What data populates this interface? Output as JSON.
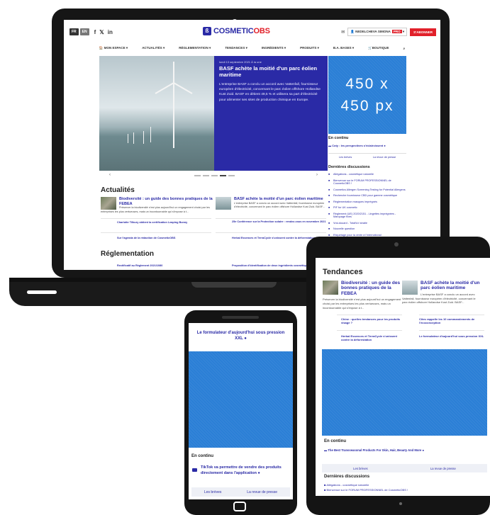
{
  "colors": {
    "brand_blue": "#2a2aa6",
    "brand_red": "#e1202a",
    "ad_blue": "#2b7fd6",
    "device_black": "#141414"
  },
  "header": {
    "languages": [
      "FR",
      "EN"
    ],
    "social": [
      "f",
      "𝕏",
      "in"
    ],
    "logo_prefix": "COSMETIC",
    "logo_suffix": "OBS",
    "mail_icon": "envelope-icon",
    "user": "NEDELCHEVA SIMONA",
    "user_badge": "PRO",
    "subscribe": "S'ABONNER"
  },
  "nav": [
    "MON ESPACE",
    "ACTUALITÉS",
    "RÉGLEMENTATION",
    "TENDANCES",
    "INGRÉDIENTS",
    "PRODUITS",
    "B.A. BASES",
    "BOUTIQUE"
  ],
  "hero": {
    "meta": "lundi 13 septembre 2021   À la une",
    "title": "BASF achète la moitié d'un parc éolien maritime",
    "body": "L'entreprise BASF a conclu un accord avec Vattenfall, fournisseur européen d'électricité, concernant le parc éolien offshore Hollandse Kust Zuid. BASF en détient 49,5 % et utilisera sa part d'électricité pour alimenter ses sites de production chimique en Europe."
  },
  "ad": {
    "line1": "450 x",
    "line2": "450 px"
  },
  "sidebar": {
    "continu_title": "En continu",
    "continu_item": "Coty : les perspectives s'éclaircissent",
    "tab_breves": "Les brèves",
    "tab_revue": "La revue de presse",
    "discussions_title": "Dernières discussions",
    "discussions": [
      "Allégations - cosmétique naturelle",
      "Bienvenue sur le FORUM PROFESSIONNEL de CosmeticOBS !",
      "Cosmetics Allergen Screening Testing for Potential Allergens",
      "Recherche fournisseur CBD pour gamme cosmétique",
      "Réglementation masques imprégnés",
      "PIF for UK cosmetic",
      "Règlement (UE) 2020/2151 - Lingettes imprégnées - Marquage fixes",
      "Vrai-douard - TotalVu! stratie",
      "Nouvelle question",
      "Etiquetage pour la vente à l'international"
    ]
  },
  "actualites": {
    "title": "Actualités",
    "a1_title": "Biodiversité : un guide des bonnes pratiques de la FEBEA",
    "a1_body": "Préserver la biodiversité n'est plus aujourd'hui un engagement choisi par les entreprises les plus vertueuses, mais un incontournable qui s'impose à t...",
    "a2_title": "BASF achète la moitié d'un parc éolien maritime",
    "a2_body": "L'entreprise BASF a conclu un accord avec Vattenfall, fournisseur européen d'électricité, concernant le parc éolien offshore Hollandse Kust Zuid. BASF...",
    "l1": "Charlotte Tilbury obtient la certification Leaping Bunny",
    "l2": "25e Conférence sur la Protection solaire : rendez-vous en novembre 2021",
    "l3": "Sur l'agenda de la rédaction de CosmeticOBS",
    "l4": "Herbal Essences et TerraCycle s'unissent contre la déforestation"
  },
  "reglementation": {
    "title": "Réglementation",
    "r1": "Rectificatif au Règlement 2021/1080",
    "r2": "Proposition d'identification de deux ingrédients cosmétiques"
  },
  "tablet": {
    "title": "Tendances",
    "a1_title": "Biodiversité : un guide des bonnes pratiques de la FEBEA",
    "a1_body": "Préserver la biodiversité n'est plus aujourd'hui un engagement choisi par les entreprises les plus vertueuses, mais un incontournable qui s'impose à t...",
    "a2_title": "BASF achète la moitié d'un parc éolien maritime",
    "a2_body": "L'entreprise BASF a conclu un accord avec Vattenfall, fournisseur européen d'électricité, concernant le parc éolien offshore Hollandse Kust Zuid. BASF...",
    "l1": "Chine : quelles tendances pour les produits visage ?",
    "l2": "Cites rappelle les 10 commandements de l'écoconception",
    "l3": "Herbal Essences et TerraCycle s'unissent contre la déforestation",
    "l4": "Le formulateur d'aujourd'hui sous pression XXL",
    "continu_title": "En continu",
    "continu_item": "The Best Transseasonal Products For Skin, Hair, Beauty And More",
    "tab_breves": "Les brèves",
    "tab_revue": "La revue de presse",
    "discussions_title": "Dernières discussions",
    "d1": "Allégations - cosmétique naturelle",
    "d2": "Bienvenue sur le FORUM PROFESSIONNEL de CosmeticOBS !"
  },
  "phone": {
    "title": "Le formulateur d'aujourd'hui sous pression XXL",
    "continu_title": "En continu",
    "item": "TikTok va permettre de vendre des produits directement dans l'application",
    "tab_breves": "Les brèves",
    "tab_revue": "La revue de presse"
  }
}
